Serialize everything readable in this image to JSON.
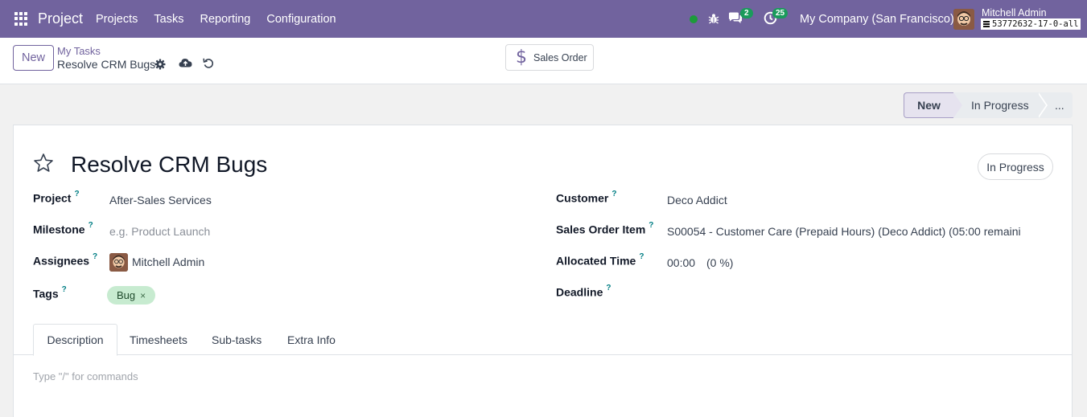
{
  "navbar": {
    "app_name": "Project",
    "menu": [
      "Projects",
      "Tasks",
      "Reporting",
      "Configuration"
    ],
    "chat_count": "2",
    "activity_count": "25",
    "company": "My Company (San Francisco)",
    "user_name": "Mitchell Admin",
    "database": "53772632-17-0-all",
    "colors": {
      "bar": "#71639e",
      "badge": "#1a9b5b",
      "online": "#1c9b3a"
    }
  },
  "control_panel": {
    "new_label": "New",
    "breadcrumb": "My Tasks",
    "record_name": "Resolve CRM Bugs",
    "smart_button": {
      "icon": "dollar-icon",
      "label": "Sales Order"
    }
  },
  "statusbar": {
    "stages": [
      "New",
      "In Progress",
      "..."
    ],
    "current": "New"
  },
  "form": {
    "title": "Resolve CRM Bugs",
    "state": "In Progress",
    "help_mark": "?",
    "left_fields": {
      "project": {
        "label": "Project",
        "value": "After-Sales Services"
      },
      "milestone": {
        "label": "Milestone",
        "placeholder": "e.g. Product Launch"
      },
      "assignees": {
        "label": "Assignees",
        "value": "Mitchell Admin"
      },
      "tags": {
        "label": "Tags",
        "value": "Bug",
        "remove": "×"
      }
    },
    "right_fields": {
      "customer": {
        "label": "Customer",
        "value": "Deco Addict"
      },
      "sale_line": {
        "label": "Sales Order Item",
        "value": "S00054 - Customer Care (Prepaid Hours) (Deco Addict) (05:00 remaini"
      },
      "allocated": {
        "label": "Allocated Time",
        "value": "00:00",
        "percent": "(0 %)"
      },
      "deadline": {
        "label": "Deadline"
      }
    },
    "tabs": [
      "Description",
      "Timesheets",
      "Sub-tasks",
      "Extra Info"
    ],
    "editor_placeholder": "Type \"/\" for commands"
  }
}
